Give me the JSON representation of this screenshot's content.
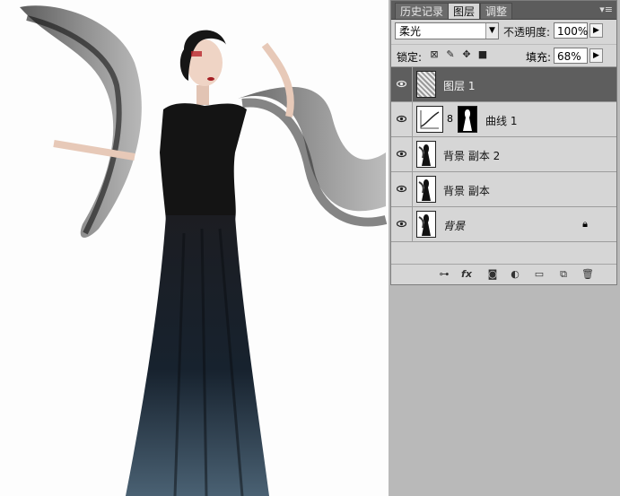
{
  "panel": {
    "tabs": [
      {
        "label": "历史记录",
        "active": false
      },
      {
        "label": "图层",
        "active": true
      },
      {
        "label": "调整",
        "active": false
      }
    ],
    "menu_icon": "panel-menu-icon",
    "blend_mode": "柔光",
    "opacity_label": "不透明度:",
    "opacity_value": "100%",
    "lock_label": "锁定:",
    "fill_label": "填充:",
    "fill_value": "68%",
    "layers": [
      {
        "name": "图层 1",
        "selected": true,
        "thumb": "noise",
        "locked": false
      },
      {
        "name": "曲线 1",
        "selected": false,
        "thumb": "curves",
        "locked": false
      },
      {
        "name": "背景 副本 2",
        "selected": false,
        "thumb": "figure",
        "locked": false
      },
      {
        "name": "背景 副本",
        "selected": false,
        "thumb": "figure",
        "locked": false
      },
      {
        "name": "背景",
        "selected": false,
        "thumb": "figure",
        "locked": true
      }
    ],
    "footer_icons": [
      "link-icon",
      "fx-icon",
      "mask-icon",
      "adjustment-icon",
      "folder-icon",
      "new-layer-icon",
      "trash-icon"
    ]
  },
  "colors": {
    "panel_bg": "#d6d6d6",
    "selected_layer": "#5e5e5e",
    "tab_bar": "#5c5c5c",
    "app_bg": "#b9b9b9"
  }
}
